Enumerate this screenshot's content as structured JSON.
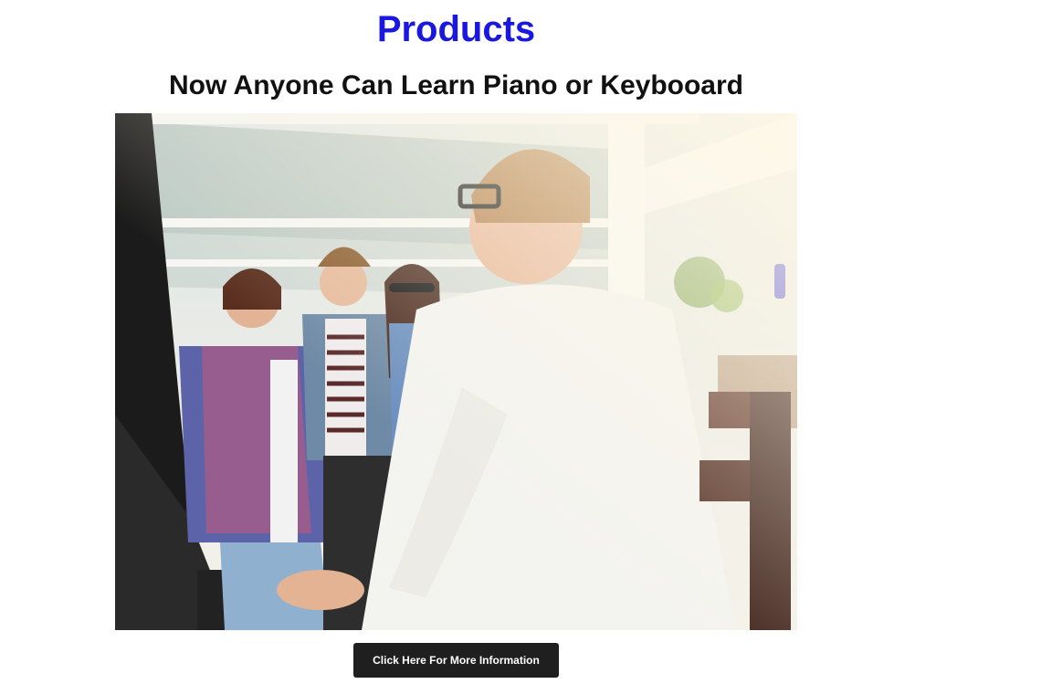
{
  "header": {
    "title": "Products",
    "subtitle": "Now Anyone Can Learn Piano or Keybooard"
  },
  "hero": {
    "alt": "Friends laughing around a man playing the piano"
  },
  "cta": {
    "label": "Click Here For More Information"
  },
  "colors": {
    "title": "#1a18e0",
    "button_bg": "#1f1f1f",
    "button_text": "#ffffff"
  }
}
